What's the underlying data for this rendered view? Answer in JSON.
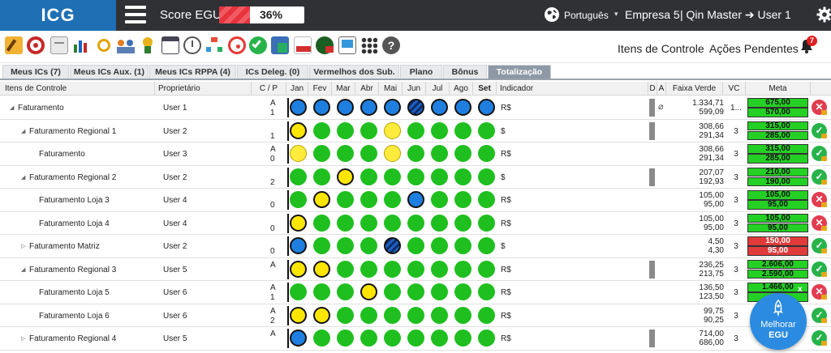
{
  "topbar": {
    "logo": "ICG",
    "score_label": "Score EGU:",
    "score_value": "36%",
    "score_percent": 36,
    "language": "Português",
    "company": "Empresa 5",
    "user_line": "| Qin Master ➔ User 1"
  },
  "toolbar": {
    "link_items": "Itens de Controle",
    "link_actions": "Ações Pendentes",
    "bell_count": "7"
  },
  "tabs": [
    {
      "label": "Meus ICs (7)"
    },
    {
      "label": "Meus ICs Aux. (1)"
    },
    {
      "label": "Meus ICs RPPA (4)"
    },
    {
      "label": "ICs Deleg. (0)"
    },
    {
      "label": "Vermelhos dos Sub."
    },
    {
      "label": "Plano"
    },
    {
      "label": "Bônus"
    },
    {
      "label": "Totalização"
    }
  ],
  "columns": {
    "item": "Itens de Controle",
    "owner": "Proprietário",
    "cp": "C / P",
    "months": [
      "Jan",
      "Fev",
      "Mar",
      "Abr",
      "Mai",
      "Jun",
      "Jul",
      "Ago",
      "Set"
    ],
    "indicator": "Indicador",
    "d": "D",
    "a": "A",
    "faixa": "Faixa Verde",
    "vc": "VC",
    "meta": "Meta"
  },
  "rows": [
    {
      "name": "Faturamento",
      "level": 0,
      "expanded": true,
      "owner": "User 1",
      "cp": [
        "A",
        "1"
      ],
      "months": [
        "b",
        "b",
        "b",
        "b",
        "b",
        "s",
        "b",
        "b",
        "b"
      ],
      "ind": "R$",
      "dbar": true,
      "clip": true,
      "fv": [
        "1.334,71",
        "599,09"
      ],
      "vc": "1...",
      "meta": [
        "675,00",
        "570,00"
      ],
      "meta_color": "green",
      "status": "x"
    },
    {
      "name": "Faturamento Regional 1",
      "level": 1,
      "expanded": true,
      "owner": "User 2",
      "cp": [
        "",
        "1"
      ],
      "months": [
        "y",
        "g",
        "g",
        "g",
        "yl",
        "g",
        "g",
        "g",
        "g"
      ],
      "ind": "$",
      "dbar": true,
      "clip": false,
      "fv": [
        "308,66",
        "291,34"
      ],
      "vc": "3",
      "meta": [
        "315,00",
        "285,00"
      ],
      "meta_color": "green",
      "status": "ok"
    },
    {
      "name": "Faturamento",
      "level": 2,
      "expanded": false,
      "owner": "User 3",
      "cp": [
        "A",
        "0"
      ],
      "months": [
        "yl",
        "g",
        "g",
        "g",
        "yl",
        "g",
        "g",
        "g",
        "g"
      ],
      "ind": "R$",
      "dbar": false,
      "clip": false,
      "fv": [
        "308,66",
        "291,34"
      ],
      "vc": "3",
      "meta": [
        "315,00",
        "285,00"
      ],
      "meta_color": "green",
      "status": "ok"
    },
    {
      "name": "Faturamento Regional 2",
      "level": 1,
      "expanded": true,
      "owner": "User 2",
      "cp": [
        "",
        "2"
      ],
      "months": [
        "g",
        "g",
        "y",
        "g",
        "g",
        "g",
        "g",
        "g",
        "g"
      ],
      "ind": "$",
      "dbar": true,
      "clip": false,
      "fv": [
        "207,07",
        "192,93"
      ],
      "vc": "3",
      "meta": [
        "210,00",
        "190,00"
      ],
      "meta_color": "green",
      "status": "ok"
    },
    {
      "name": "Faturamento Loja 3",
      "level": 2,
      "expanded": false,
      "owner": "User 4",
      "cp": [
        "",
        "0"
      ],
      "months": [
        "g",
        "y",
        "g",
        "g",
        "g",
        "b",
        "g",
        "g",
        "g"
      ],
      "ind": "R$",
      "dbar": false,
      "clip": false,
      "fv": [
        "105,00",
        "95,00"
      ],
      "vc": "3",
      "meta": [
        "105,00",
        "95,00"
      ],
      "meta_color": "green",
      "status": "x"
    },
    {
      "name": "Faturamento Loja 4",
      "level": 2,
      "expanded": false,
      "owner": "User 4",
      "cp": [
        "",
        "0"
      ],
      "months": [
        "y",
        "g",
        "g",
        "g",
        "g",
        "g",
        "g",
        "g",
        "g"
      ],
      "ind": "R$",
      "dbar": false,
      "clip": false,
      "fv": [
        "105,00",
        "95,00"
      ],
      "vc": "3",
      "meta": [
        "105,00",
        "95,00"
      ],
      "meta_color": "green",
      "status": "x"
    },
    {
      "name": "Faturamento Matriz",
      "level": 1,
      "expanded": false,
      "owner": "User 2",
      "cp": [
        "",
        "0"
      ],
      "months": [
        "b",
        "g",
        "g",
        "g",
        "s",
        "g",
        "g",
        "g",
        "g"
      ],
      "ind": "$",
      "dbar": false,
      "clip": false,
      "fv": [
        "4,50",
        "4,30"
      ],
      "vc": "3",
      "meta": [
        "150,00",
        "95,00"
      ],
      "meta_color": "red",
      "status": "ok"
    },
    {
      "name": "Faturamento Regional 3",
      "level": 1,
      "expanded": true,
      "owner": "User 5",
      "cp": [
        "A",
        ""
      ],
      "months": [
        "y",
        "y",
        "g",
        "g",
        "g",
        "g",
        "g",
        "g",
        "g"
      ],
      "ind": "R$",
      "dbar": true,
      "clip": false,
      "fv": [
        "236,25",
        "213,75"
      ],
      "vc": "3",
      "meta": [
        "2.606,00",
        "2.590,00"
      ],
      "meta_color": "green",
      "status": "ok"
    },
    {
      "name": "Faturamento Loja 5",
      "level": 2,
      "expanded": false,
      "owner": "User 6",
      "cp": [
        "A",
        "1"
      ],
      "months": [
        "g",
        "g",
        "g",
        "y",
        "g",
        "g",
        "g",
        "g",
        "g"
      ],
      "ind": "R$",
      "dbar": false,
      "clip": false,
      "fv": [
        "136,50",
        "123,50"
      ],
      "vc": "3",
      "meta": [
        "1.466,00",
        ""
      ],
      "meta_color": "green",
      "status": "x"
    },
    {
      "name": "Faturamento Loja 6",
      "level": 2,
      "expanded": false,
      "owner": "User 6",
      "cp": [
        "A",
        "2"
      ],
      "months": [
        "y",
        "y",
        "g",
        "g",
        "g",
        "g",
        "g",
        "g",
        "g"
      ],
      "ind": "R$",
      "dbar": false,
      "clip": false,
      "fv": [
        "99,75",
        "90,25"
      ],
      "vc": "3",
      "meta": [
        "",
        ""
      ],
      "meta_color": "green",
      "status": "ok"
    },
    {
      "name": "Faturamento Regional 4",
      "level": 1,
      "expanded": false,
      "owner": "User 5",
      "cp": [
        "A",
        ""
      ],
      "months": [
        "b",
        "g",
        "g",
        "g",
        "g",
        "g",
        "g",
        "g",
        "g"
      ],
      "ind": "R$",
      "dbar": true,
      "clip": false,
      "fv": [
        "714,00",
        "686,00"
      ],
      "vc": "3",
      "meta": [
        "",
        ""
      ],
      "meta_color": "green",
      "status": "ok"
    }
  ],
  "widget": {
    "line1": "Melhorar",
    "line2": "EGU",
    "close": "x"
  },
  "colors": {
    "topbar": "#2f3135",
    "logo": "#1e6fb3",
    "green_dot": "#1fbf1f",
    "yellow_dot": "#ffe600",
    "blue_dot": "#1f7fe0",
    "meta_green": "#25d025",
    "meta_red": "#e03a3a"
  }
}
